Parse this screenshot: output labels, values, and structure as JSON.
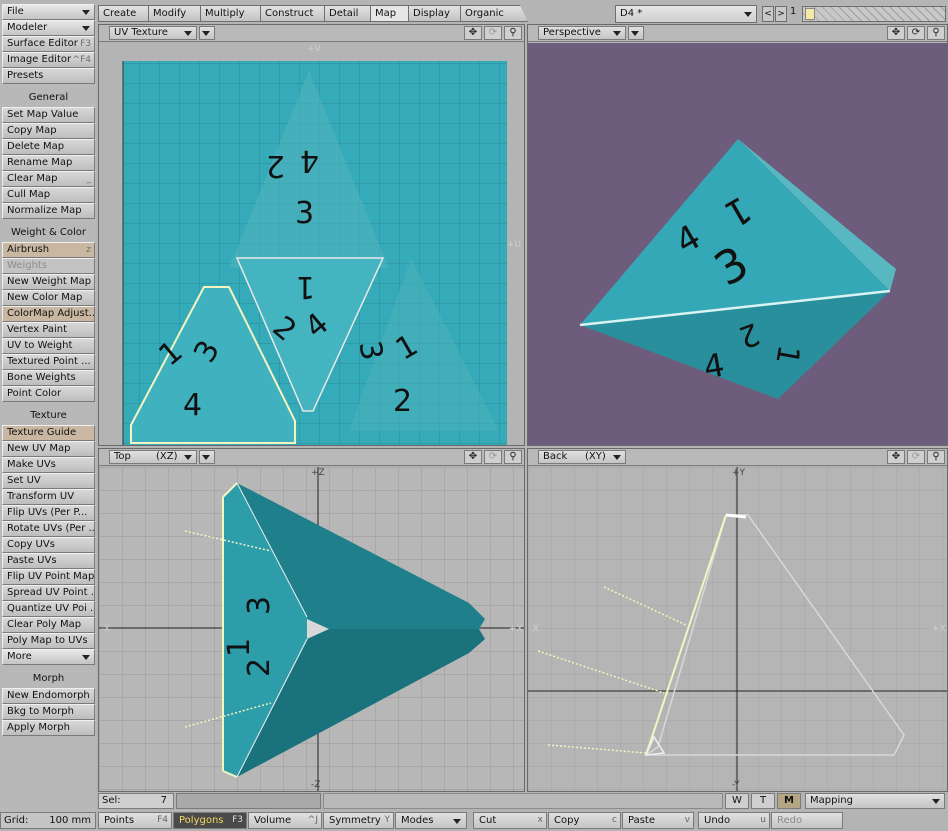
{
  "sidebar": {
    "top": [
      {
        "label": "File",
        "dropdown": true
      },
      {
        "label": "Modeler",
        "dropdown": true
      },
      {
        "label": "Surface Editor",
        "key": "F3"
      },
      {
        "label": "Image Editor",
        "key": "^F4"
      },
      {
        "label": "Presets",
        "key": ""
      }
    ],
    "general_header": "General",
    "general": [
      {
        "label": "Set Map Value"
      },
      {
        "label": "Copy Map"
      },
      {
        "label": "Delete Map"
      },
      {
        "label": "Rename Map"
      },
      {
        "label": "Clear Map",
        "key": "_"
      },
      {
        "label": "Cull Map"
      },
      {
        "label": "Normalize Map"
      }
    ],
    "weight_header": "Weight & Color",
    "weight": [
      {
        "label": "Airbrush",
        "key": "z",
        "state": "hi"
      },
      {
        "label": "Weights",
        "state": "dim"
      },
      {
        "label": "New Weight Map"
      },
      {
        "label": "New Color Map"
      },
      {
        "label": "ColorMap Adjust...",
        "state": "hi"
      },
      {
        "label": "Vertex Paint"
      },
      {
        "label": "UV to Weight"
      },
      {
        "label": "Textured Point ..."
      },
      {
        "label": "Bone Weights"
      },
      {
        "label": "Point Color"
      }
    ],
    "texture_header": "Texture",
    "texture": [
      {
        "label": "Texture Guide",
        "state": "hi"
      },
      {
        "label": "New UV Map"
      },
      {
        "label": "Make UVs"
      },
      {
        "label": "Set UV"
      },
      {
        "label": "Transform UV"
      },
      {
        "label": "Flip UVs (Per P..."
      },
      {
        "label": "Rotate UVs (Per ..."
      },
      {
        "label": "Copy UVs"
      },
      {
        "label": "Paste UVs"
      },
      {
        "label": "Flip UV Point Map"
      },
      {
        "label": "Spread UV Point ..."
      },
      {
        "label": "Quantize UV Poi ..."
      },
      {
        "label": "Clear Poly Map"
      },
      {
        "label": "Poly Map to UVs"
      },
      {
        "label": "More",
        "dropdown": true
      }
    ],
    "morph_header": "Morph",
    "morph": [
      {
        "label": "New Endomorph"
      },
      {
        "label": "Bkg to Morph"
      },
      {
        "label": "Apply Morph"
      }
    ]
  },
  "tabs": [
    "Create",
    "Modify",
    "Multiply",
    "Construct",
    "Detail",
    "Map",
    "Display",
    "Organic"
  ],
  "active_tab": "Map",
  "object_selector": "D4 *",
  "layer_number": "1",
  "viewports": {
    "uv": {
      "title": "UV Texture",
      "axis_top": "+V",
      "axis_right": "+U"
    },
    "perspective": {
      "title": "Perspective",
      "bg_color": "#6e5c7d"
    },
    "top": {
      "title": "Top",
      "plane": "(XZ)",
      "axis_top": "+Z",
      "axis_bottom": "-Z",
      "axis_left": "-X",
      "axis_right": "+X"
    },
    "back": {
      "title": "Back",
      "plane": "(XY)",
      "axis_top": "+Y",
      "axis_bottom": "-Y",
      "axis_left": "-X",
      "axis_right": "+X"
    }
  },
  "icons": {
    "pan": "✥",
    "rotate": "⟳",
    "zoom": "🔍"
  },
  "status": {
    "sel_label": "Sel:",
    "sel_value": "7",
    "w": "W",
    "t": "T",
    "m": "M",
    "mapping": "Mapping"
  },
  "bottom": {
    "grid_label": "Grid:",
    "grid_value": "100 mm",
    "points": {
      "label": "Points",
      "key": "F4"
    },
    "polygons": {
      "label": "Polygons",
      "key": "F3"
    },
    "volume": {
      "label": "Volume",
      "key": "^J"
    },
    "symmetry": {
      "label": "Symmetry",
      "key": "Y"
    },
    "modes": {
      "label": "Modes"
    },
    "cut": {
      "label": "Cut",
      "key": "x"
    },
    "copy": {
      "label": "Copy",
      "key": "c"
    },
    "paste": {
      "label": "Paste",
      "key": "v"
    },
    "undo": {
      "label": "Undo",
      "key": "u"
    },
    "redo": {
      "label": "Redo"
    }
  },
  "texture_labels": {
    "uv_top": [
      "2",
      "4",
      "3"
    ],
    "uv_mid": [
      "1",
      "2",
      "4"
    ],
    "uv_left": [
      "1",
      "3",
      "4"
    ],
    "uv_right": [
      "3",
      "1",
      "2"
    ],
    "persp": [
      "4",
      "3",
      "1",
      "2",
      "4",
      "1"
    ]
  }
}
